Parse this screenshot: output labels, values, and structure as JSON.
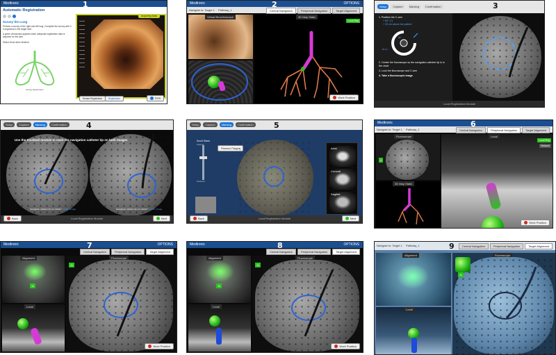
{
  "brand": "Medtronic",
  "options_label": "OPTIONS",
  "panels": [
    {
      "number": "1",
      "title": "Automatic Registration",
      "heading": "Survey the Lung",
      "instructions": "Perform a survey in the right and left lung. Complete the survey with 2-3 segments in the target lobe.",
      "note": "A green checkmark appears when adequate registration data is acquired for the lobe.",
      "select_done": "Select Done when finished",
      "status_badge": "Acquiring Data",
      "lung_caption": "Airway Registration",
      "restart_button": "Restart Registration",
      "registration_button": "Registration",
      "done_button": "Done"
    },
    {
      "number": "2",
      "nav_label": "Navigate to: Target 1",
      "pathway": "Pathway_1",
      "tabs": [
        "Central Navigation",
        "Peripheral Navigation",
        "Target Alignment"
      ],
      "view_label_left": "Virtual Bronchoscope",
      "view_label_right": "3D Map Static",
      "local_reg": "Local Reg",
      "work_position": "Work Position"
    },
    {
      "number": "3",
      "steps": [
        "Setup",
        "Capture",
        "Marking",
        "Confirmation"
      ],
      "instruction_1": "1. Position the C-arm",
      "angle_1": "+ 60° (?)",
      "angle_2": "+ 25 cm above the patient",
      "instruction_2": "2. Center the fluoroscope so the navigation catheter tip is in the circle",
      "instruction_3": "3. Lock the fluoroscope and C-arm",
      "instruction_4": "4. Take a fluoroscopic image",
      "angle_left": "-25 cm",
      "angle_top": "60°",
      "footer": "Local Registration Module"
    },
    {
      "number": "4",
      "steps": [
        "Setup",
        "Capture",
        "Marking",
        "Confirmation"
      ],
      "instruction": "Use the trackball module to mark the navigation catheter tip on both images",
      "caption_left": "Navigation catheter tip not visible?",
      "caption_right": "Navigation catheter tip not visible?",
      "link": "Confirm image",
      "back": "Back",
      "next": "Next",
      "footer": "Local Registration Module"
    },
    {
      "number": "5",
      "steps": [
        "Setup",
        "Capture",
        "Marking",
        "Confirmation"
      ],
      "scroll_label": "Scroll Slices",
      "planned_target": "Planned Target",
      "anterior": "Anterior",
      "posterior": "Posterior",
      "side_labels": [
        "Axial",
        "Coronal",
        "Sagittal"
      ],
      "back": "Back",
      "next": "Next",
      "footer": "Local Registration Module"
    },
    {
      "number": "6",
      "nav_label": "Navigate to: Target 1",
      "pathway": "Pathway_1",
      "tabs": [
        "Central Navigation",
        "Peripheral Navigation",
        "Target Alignment"
      ],
      "fluoro_label": "Fluoroscope",
      "map_label": "3D Map Static",
      "local_label": "Local",
      "local_reg": "Local Reg",
      "network": "Network",
      "work_position": "Work Position",
      "distance": "4"
    },
    {
      "number": "7",
      "nav_label": "Navigate to: Target 1",
      "pathway": "Pathway_1",
      "tabs": [
        "Central Navigation",
        "Peripheral Navigation",
        "Target Alignment"
      ],
      "alignment_label": "Alignment",
      "fluoro_label": "Fluoroscope",
      "local_label": "Local",
      "work_position": "Work Position",
      "distance": "11"
    },
    {
      "number": "8",
      "nav_label": "Navigate to: Target 1",
      "pathway": "Pathway_1",
      "tabs": [
        "Central Navigation",
        "Peripheral Navigation",
        "Target Alignment"
      ],
      "alignment_label": "Alignment",
      "fluoro_label": "Fluoroscope",
      "local_label": "Local",
      "work_position": "Work Position",
      "distance": "11"
    },
    {
      "number": "9",
      "nav_label": "Navigate to: Target 1",
      "pathway": "Pathway_1",
      "tabs": [
        "Central Navigation",
        "Peripheral Navigation",
        "Target Alignment"
      ],
      "alignment_label": "Alignment",
      "fluoro_label": "Fluoroscope",
      "local_label": "Local",
      "distance": "11"
    }
  ],
  "colors": {
    "brand_blue": "#1b4f92",
    "target_green": "#2bc21f",
    "ring_blue": "#2e63d6",
    "catheter_magenta": "#d63ad6",
    "catheter_blue": "#1e4bd8",
    "airway_orange": "#e07a4a"
  }
}
